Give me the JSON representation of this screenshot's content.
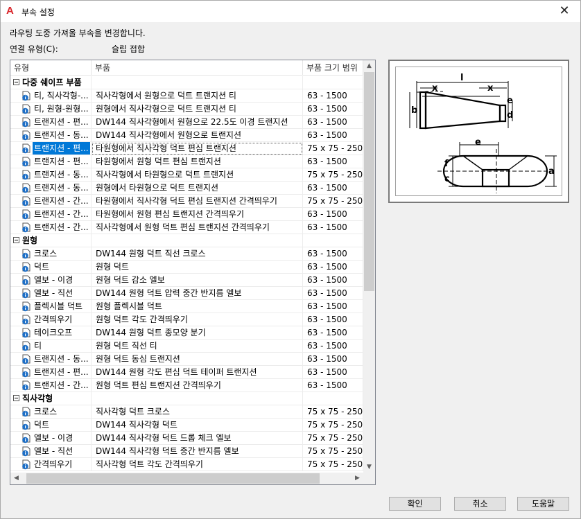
{
  "window": {
    "title": "부속 설정",
    "close_glyph": "✕"
  },
  "description": "라우팅 도중 가져올 부속을 변경합니다.",
  "connection": {
    "label": "연결 유형(C):",
    "value": "슬립 접합"
  },
  "columns": [
    "유형",
    "부품",
    "부품 크기 범위"
  ],
  "groups": [
    {
      "name": "다중 쉐이프 부품",
      "items": [
        {
          "type": "티, 직사각형-...",
          "part": "직사각형에서 원형으로 덕트 트랜지션 티",
          "range": "63 - 1500"
        },
        {
          "type": "티, 원형-원형...",
          "part": "원형에서 직사각형으로 덕트 트랜지션 티",
          "range": "63 - 1500"
        },
        {
          "type": "트랜지션 - 편...",
          "part": "DW144 직사각형에서 원형으로 22.5도 이경 트랜지션",
          "range": "63 - 1500"
        },
        {
          "type": "트랜지션 - 동...",
          "part": "DW144 직사각형에서 원형으로 트랜지션",
          "range": "63 - 1500"
        },
        {
          "type": "트랜지션 - 편...",
          "part": "타원형에서 직사각형 덕트 편심 트랜지션",
          "range": "75 x 75 - 2500",
          "selected": true
        },
        {
          "type": "트랜지션 - 편...",
          "part": "타원형에서 원형 덕트 편심 트랜지션",
          "range": "63 - 1500"
        },
        {
          "type": "트랜지션 - 동...",
          "part": "직사각형에서 타원형으로 덕트 트랜지션",
          "range": "75 x 75 - 2500"
        },
        {
          "type": "트랜지션 - 동...",
          "part": "원형에서 타원형으로 덕트 트랜지션",
          "range": "63 - 1500"
        },
        {
          "type": "트랜지션 - 간...",
          "part": "타원형에서 직사각형 덕트 편심 트랜지션 간격띄우기",
          "range": "75 x 75 - 2500"
        },
        {
          "type": "트랜지션 - 간...",
          "part": "타원형에서 원형 편심 트랜지션 간격띄우기",
          "range": "63 - 1500"
        },
        {
          "type": "트랜지션 - 간...",
          "part": "직사각형에서 원형 덕트 편심 트랜지션 간격띄우기",
          "range": "63 - 1500"
        }
      ]
    },
    {
      "name": "원형",
      "items": [
        {
          "type": "크로스",
          "part": "DW144 원형 덕트 직선 크로스",
          "range": "63 - 1500"
        },
        {
          "type": "덕트",
          "part": "원형 덕트",
          "range": "63 - 1500"
        },
        {
          "type": "엘보 - 이경",
          "part": "원형 덕트 감소 엘보",
          "range": "63 - 1500"
        },
        {
          "type": "엘보 - 직선",
          "part": "DW144 원형 덕트 압력 중간 반지름 엘보",
          "range": "63 - 1500"
        },
        {
          "type": "플렉시블 덕트",
          "part": "원형 플렉시블 덕트",
          "range": "63 - 1500"
        },
        {
          "type": "간격띄우기",
          "part": "원형 덕트 각도 간격띄우기",
          "range": "63 - 1500"
        },
        {
          "type": "테이크오프",
          "part": "DW144 원형 덕트 종모양 분기",
          "range": "63 - 1500"
        },
        {
          "type": "티",
          "part": "원형 덕트 직선 티",
          "range": "63 - 1500"
        },
        {
          "type": "트랜지션 - 동...",
          "part": "원형 덕트 동심 트랜지션",
          "range": "63 - 1500"
        },
        {
          "type": "트랜지션 - 편...",
          "part": "DW144 원형 각도 편심 덕트 테이퍼 트랜지션",
          "range": "63 - 1500"
        },
        {
          "type": "트랜지션 - 간...",
          "part": "원형 덕트 편심 트랜지션 간격띄우기",
          "range": "63 - 1500"
        }
      ]
    },
    {
      "name": "직사각형",
      "items": [
        {
          "type": "크로스",
          "part": "직사각형 덕트 크로스",
          "range": "75 x 75 - 2500"
        },
        {
          "type": "덕트",
          "part": "DW144 직사각형 덕트",
          "range": "75 x 75 - 2500"
        },
        {
          "type": "엘보 - 이경",
          "part": "DW144 직사각형 덕트 드롭 체크 엘보",
          "range": "75 x 75 - 2500"
        },
        {
          "type": "엘보 - 직선",
          "part": "DW144 직사각형 덕트 중간 반지름 엘보",
          "range": "75 x 75 - 2500"
        },
        {
          "type": "간격띄우기",
          "part": "직사각형 덕트 각도 간격띄우기",
          "range": "75 x 75 - 2500"
        }
      ]
    }
  ],
  "preview": {
    "labels": {
      "l": "l",
      "x": "x",
      "b": "b",
      "d": "d",
      "e": "e",
      "f": "f",
      "c": "c",
      "a": "a"
    }
  },
  "buttons": {
    "ok": "확인",
    "cancel": "취소",
    "help": "도움말"
  },
  "colors": {
    "selection": "#0078d7",
    "info_icon": "#1e6fc6",
    "logo": "#d9262b"
  }
}
